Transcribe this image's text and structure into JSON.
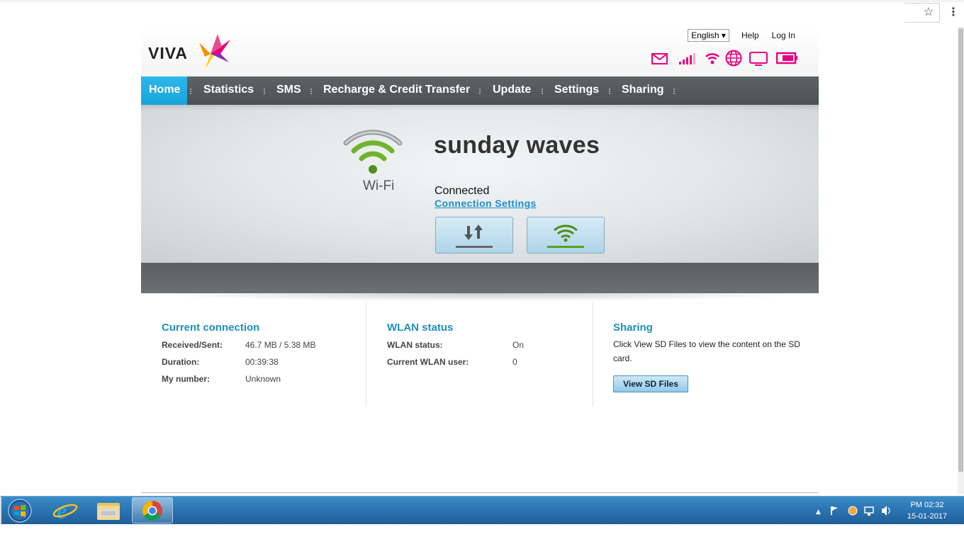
{
  "browser": {
    "star_glyph": "☆",
    "menu_glyph": "⋮"
  },
  "header": {
    "logo_text": "VIVA",
    "language": "English ▾",
    "help": "Help",
    "login": "Log In",
    "status_icons": [
      "envelope-icon",
      "signal-bars-icon",
      "wifi-icon",
      "globe-icon",
      "monitor-icon",
      "battery-icon"
    ],
    "accent_color": "#e6007e"
  },
  "nav": {
    "items": [
      "Home",
      "Statistics",
      "SMS",
      "Recharge & Credit Transfer",
      "Update",
      "Settings",
      "Sharing"
    ],
    "active": "Home",
    "active_color": "#1aa7de"
  },
  "hero": {
    "wifi_label": "Wi-Fi",
    "network_name": "sunday waves",
    "status": "Connected",
    "settings_link": "Connection Settings"
  },
  "current_connection": {
    "title": "Current connection",
    "rows": [
      {
        "label": "Received/Sent:",
        "value": "46.7 MB /  5.38 MB"
      },
      {
        "label": "Duration:",
        "value": "00:39:38"
      },
      {
        "label": "My number:",
        "value": "Unknown"
      }
    ]
  },
  "wlan": {
    "title": "WLAN status",
    "rows": [
      {
        "label": "WLAN status:",
        "value": "On"
      },
      {
        "label": "Current WLAN user:",
        "value": "0"
      }
    ]
  },
  "sharing": {
    "title": "Sharing",
    "text": "Click View SD Files to view the content on the SD card.",
    "button": "View SD Files"
  },
  "taskbar": {
    "apps": [
      "internet-explorer-icon",
      "file-explorer-icon",
      "chrome-icon"
    ],
    "tray_chevron": "▲",
    "clock_time": "PM 02:32",
    "clock_date": "15-01-2017"
  }
}
